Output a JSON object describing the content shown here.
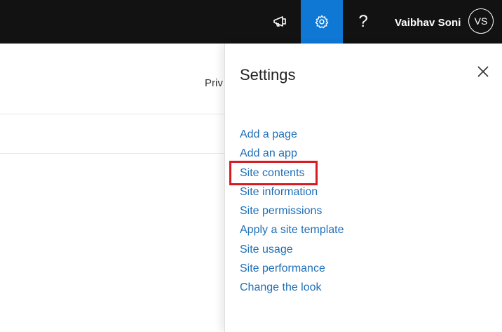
{
  "topbar": {
    "megaphone_icon": "megaphone-icon",
    "settings_icon": "gear-icon",
    "help_label": "?",
    "user_name": "Vaibhav Soni",
    "user_initials": "VS",
    "accent_color": "#0f78d4",
    "background_color": "#121212"
  },
  "background": {
    "clipped_text": "Priv"
  },
  "settings_panel": {
    "title": "Settings",
    "close_icon": "close-icon",
    "items": [
      {
        "label": "Add a page"
      },
      {
        "label": "Add an app"
      },
      {
        "label": "Site contents"
      },
      {
        "label": "Site information"
      },
      {
        "label": "Site permissions"
      },
      {
        "label": "Apply a site template"
      },
      {
        "label": "Site usage"
      },
      {
        "label": "Site performance"
      },
      {
        "label": "Change the look"
      }
    ],
    "link_color": "#1f6fb8",
    "highlight_color": "#d81b22"
  }
}
